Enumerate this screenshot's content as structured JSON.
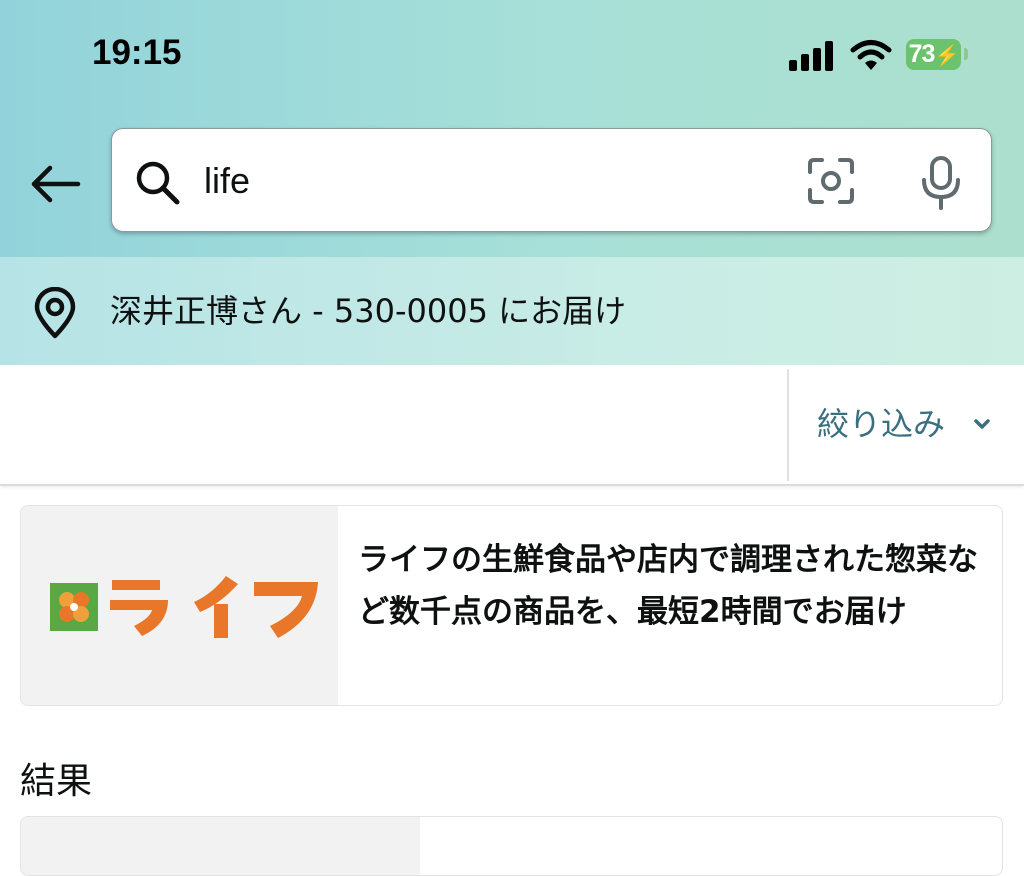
{
  "status_bar": {
    "time": "19:15",
    "battery_level": "73",
    "icons": [
      "signal-icon",
      "wifi-icon",
      "battery-icon"
    ]
  },
  "header": {
    "back_icon": "back-arrow-icon",
    "search": {
      "value": "life",
      "icons": [
        "search-icon",
        "camera-icon",
        "microphone-icon"
      ]
    }
  },
  "delivery": {
    "icon": "location-pin-icon",
    "text": "深井正博さん - 530-0005 にお届け"
  },
  "filter": {
    "label": "絞り込み",
    "icon": "chevron-down-icon"
  },
  "promo": {
    "logo_text": "ライフ",
    "description": "ライフの生鮮食品や店内で調理された惣菜など数千点の商品を、最短2時間でお届け"
  },
  "results": {
    "heading": "結果"
  },
  "colors": {
    "header_gradient_start": "#92d3db",
    "header_gradient_end": "#acdfcd",
    "filter_text": "#3a6f7f",
    "battery": "#6bc46d",
    "logo_orange": "#e8772a",
    "logo_green": "#5aa843"
  }
}
